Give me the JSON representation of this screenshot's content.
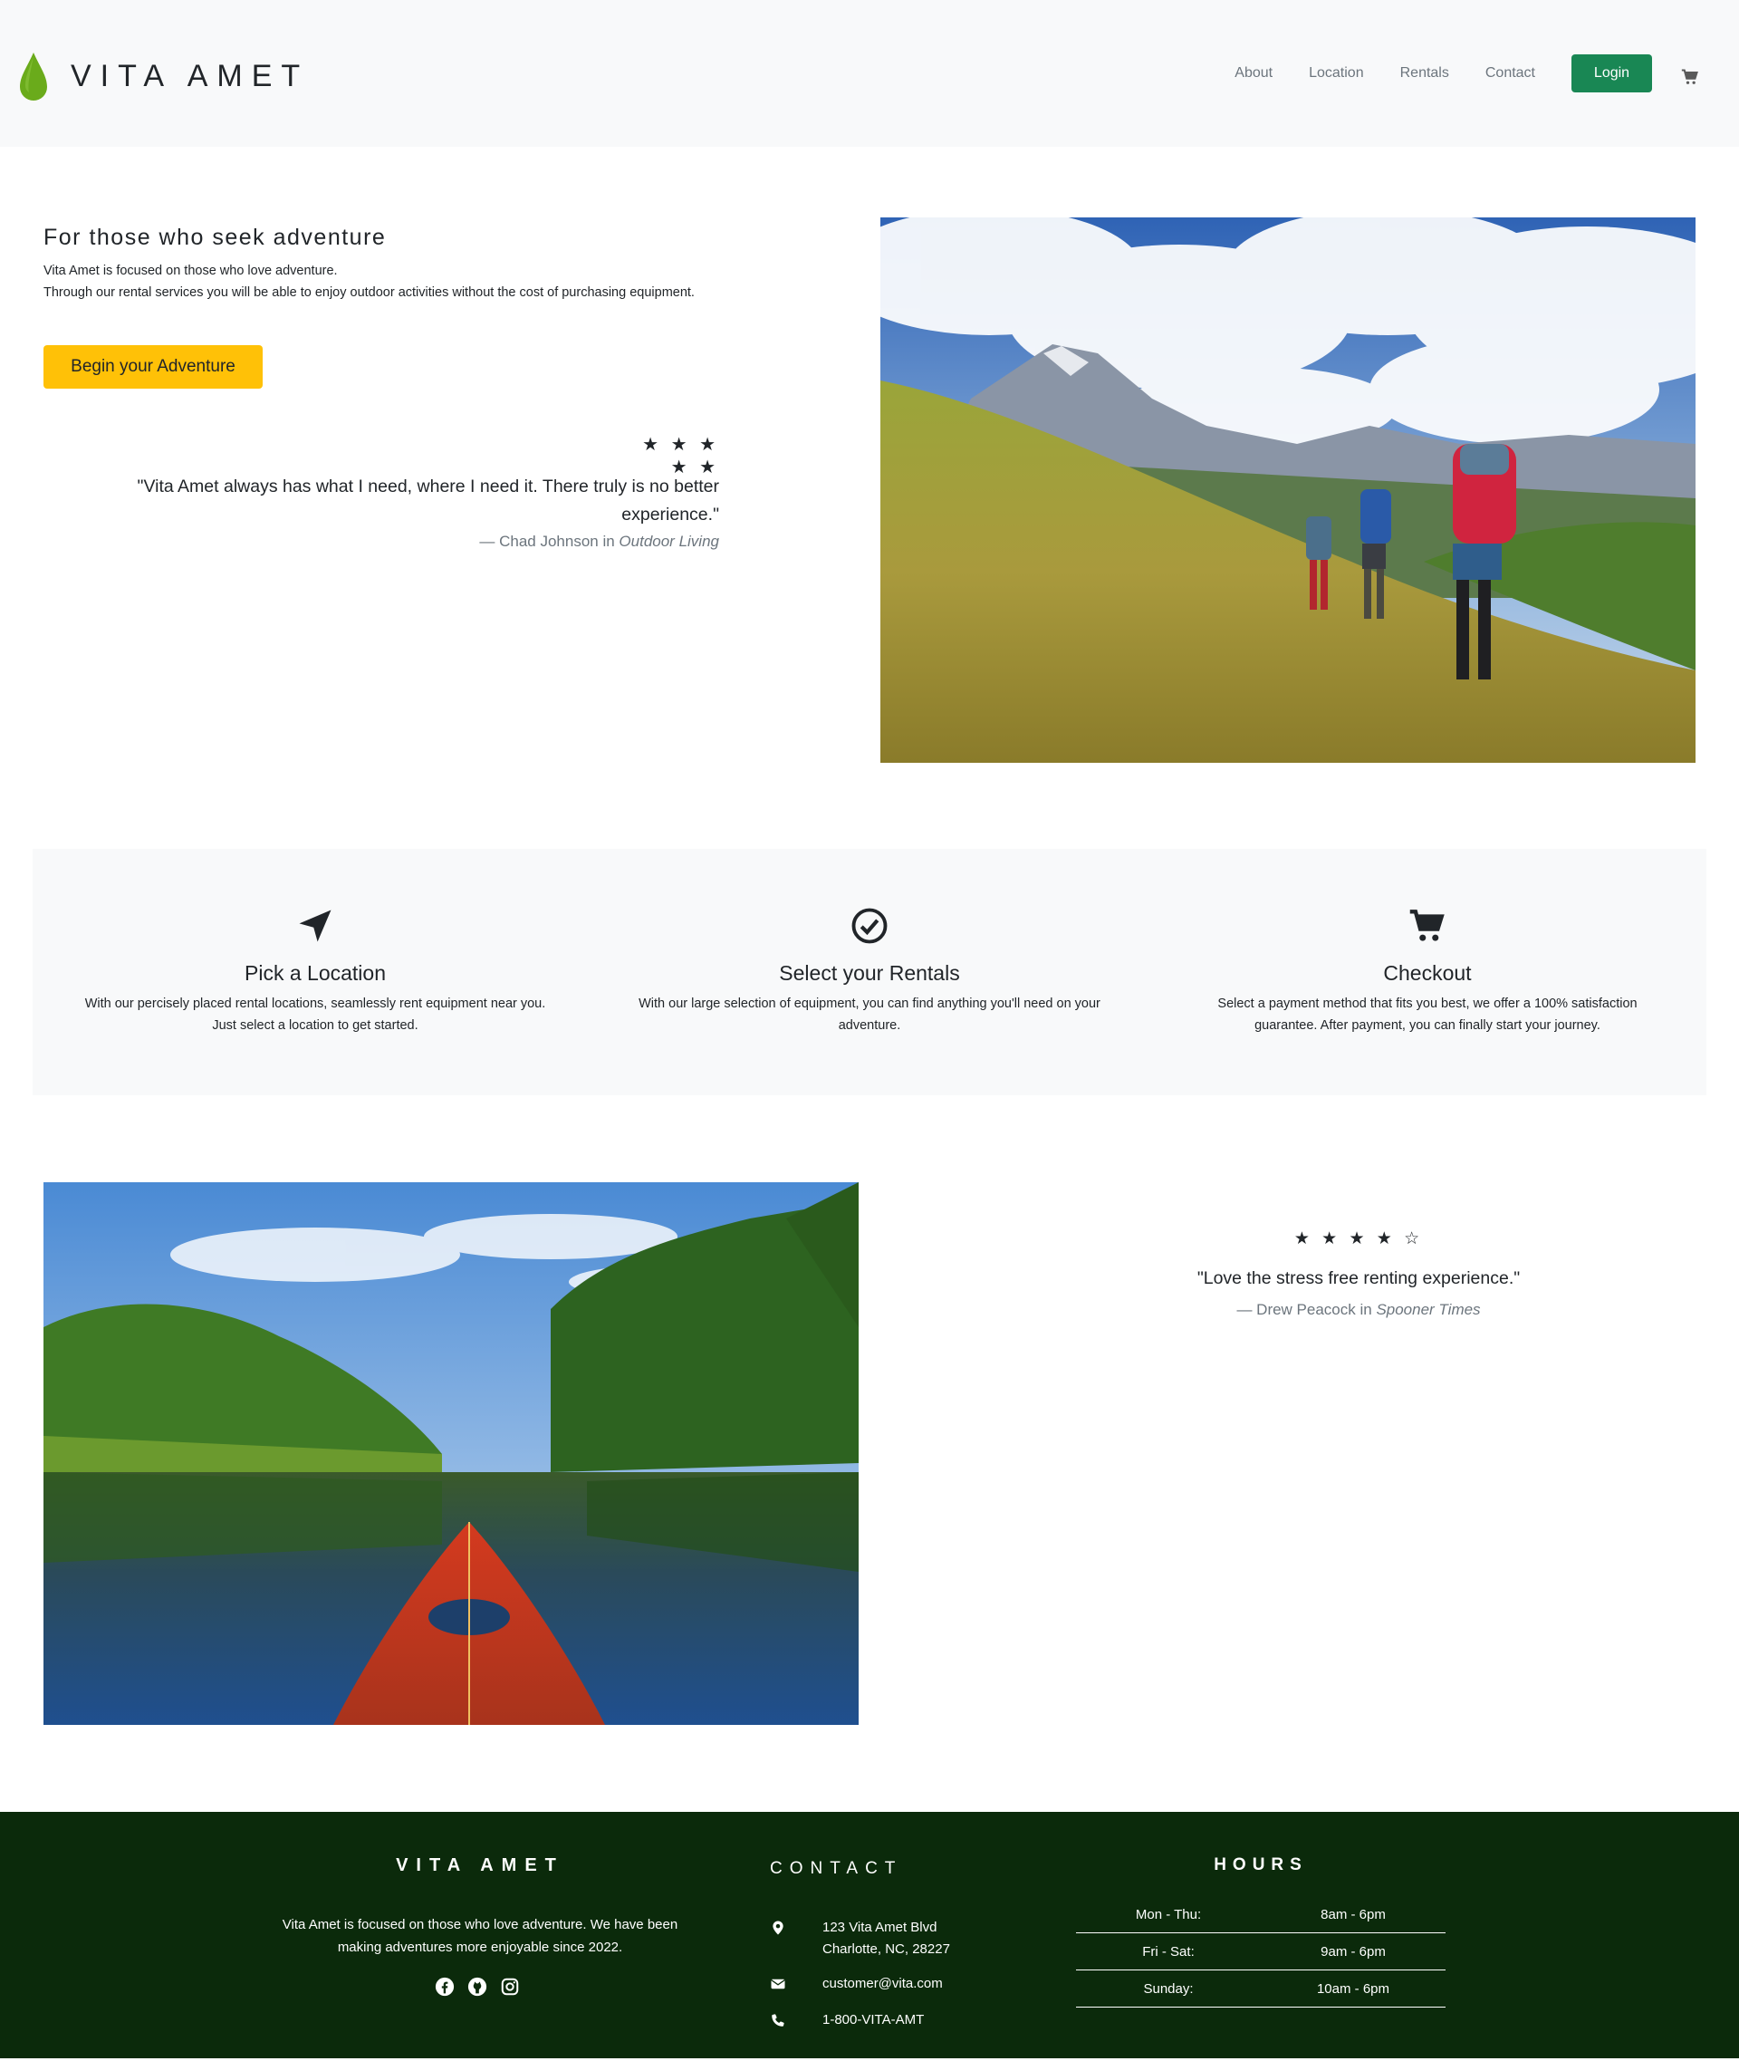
{
  "brand": {
    "name": "VITA AMET",
    "accent": "#6aab1b"
  },
  "nav": {
    "links": [
      "About",
      "Location",
      "Rentals",
      "Contact"
    ],
    "login_label": "Login",
    "login_color": "#198754",
    "cart_icon": "cart-icon"
  },
  "hero": {
    "title": "For those who seek adventure",
    "lead_1": "Vita Amet is focused on those who love adventure.",
    "lead_2": "Through our rental services you will be able to enjoy outdoor activities without the cost of purchasing equipment.",
    "cta_label": "Begin your Adventure",
    "cta_color": "#ffc107",
    "rating": {
      "stars": "★ ★ ★ ★ ★",
      "value": 5,
      "max": 5
    },
    "quote": "\"Vita Amet always has what I need, where I need it. There truly is no better experience.\"",
    "cite_prefix": "— Chad Johnson in ",
    "cite_source": "Outdoor Living"
  },
  "steps": [
    {
      "icon": "location-arrow-icon",
      "title": "Pick a Location",
      "desc": "With our percisely placed rental locations, seamlessly rent equipment near you. Just select a location to get started."
    },
    {
      "icon": "check-circle-icon",
      "title": "Select your Rentals",
      "desc": "With our large selection of equipment, you can find anything you'll need on your adventure."
    },
    {
      "icon": "cart-icon",
      "title": "Checkout",
      "desc": "Select a payment method that fits you best, we offer a 100% satisfaction guarantee. After payment, you can finally start your journey."
    }
  ],
  "testimonial_2": {
    "rating": {
      "stars": "★ ★ ★ ★ ☆",
      "value": 4,
      "max": 5
    },
    "quote": "\"Love the stress free renting experience.\"",
    "cite_prefix": "— Drew Peacock in ",
    "cite_source": "Spooner Times"
  },
  "footer": {
    "brand": "VITA AMET",
    "about": "Vita Amet is focused on those who love adventure. We have been making adventures more enjoyable since 2022.",
    "social": [
      "facebook-icon",
      "github-icon",
      "instagram-icon"
    ],
    "contact_heading": "CONTACT",
    "address_1": "123 Vita Amet Blvd",
    "address_2": "Charlotte, NC, 28227",
    "email": "customer@vita.com",
    "phone": "1-800-VITA-AMT",
    "hours_heading": "HOURS",
    "hours": [
      {
        "day": "Mon - Thu:",
        "time": "8am - 6pm"
      },
      {
        "day": "Fri - Sat:",
        "time": "9am - 6pm"
      },
      {
        "day": "Sunday:",
        "time": "10am - 6pm"
      }
    ],
    "bg_color": "#0b2a0b"
  }
}
